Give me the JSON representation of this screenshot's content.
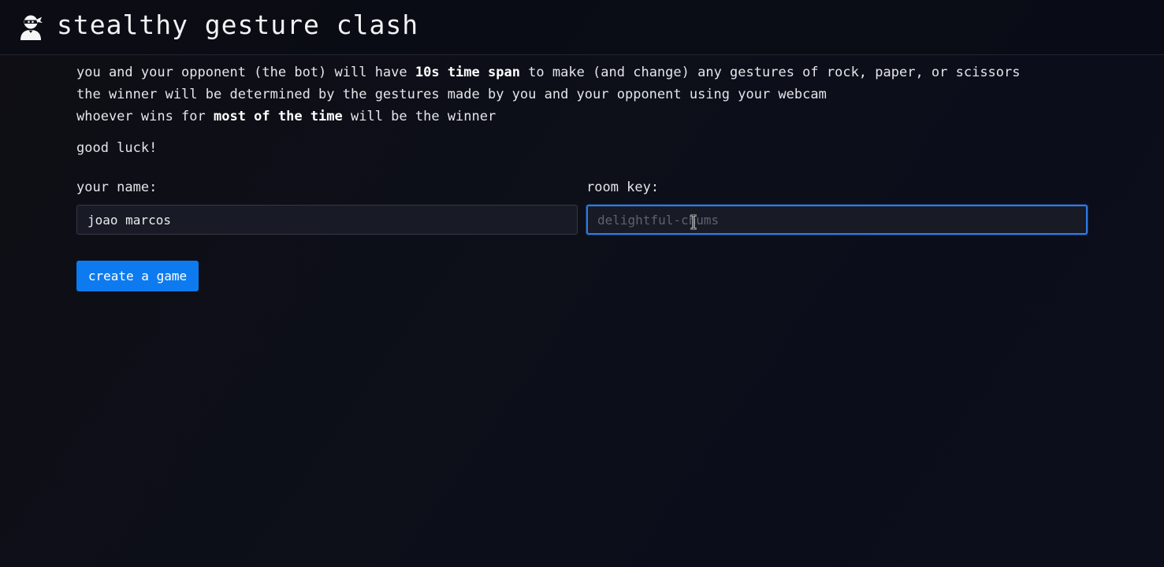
{
  "header": {
    "title": "stealthy gesture clash",
    "logo_icon": "ninja-user-icon"
  },
  "rules": {
    "line1": {
      "before": "you and your opponent (the bot) will have ",
      "bold": "10s time span",
      "after": " to make (and change) any gestures of rock, paper, or scissors"
    },
    "line2": "the winner will be determined by the gestures made by you and your opponent using your webcam",
    "line3": {
      "before": "whoever wins for ",
      "bold": "most of the time",
      "after": " will be the winner"
    },
    "good_luck": "good luck!"
  },
  "form": {
    "name_label": "your name:",
    "name_value": "joao marcos",
    "room_label": "room key:",
    "room_value": "",
    "room_placeholder": "delightful-chums",
    "create_button": "create a game"
  },
  "colors": {
    "accent": "#0d7bef",
    "focus_border": "#2f7be6",
    "background": "#0d0f19"
  }
}
